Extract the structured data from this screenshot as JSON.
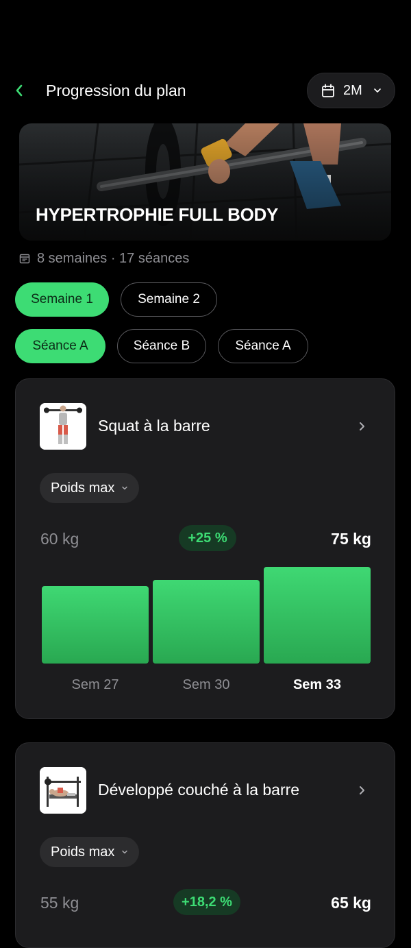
{
  "header": {
    "title": "Progression du plan",
    "period": "2M"
  },
  "hero": {
    "title": "HYPERTROPHIE FULL BODY"
  },
  "meta": {
    "text": "8 semaines · 17 séances"
  },
  "weeks": [
    {
      "label": "Semaine 1",
      "active": true
    },
    {
      "label": "Semaine 2",
      "active": false
    }
  ],
  "sessions": [
    {
      "label": "Séance A",
      "active": true
    },
    {
      "label": "Séance B",
      "active": false
    },
    {
      "label": "Séance A",
      "active": false
    }
  ],
  "exercises": [
    {
      "name": "Squat à la barre",
      "metric": "Poids max",
      "start": "60 kg",
      "delta": "+25 %",
      "end": "75 kg",
      "chart_data": {
        "type": "bar",
        "categories": [
          "Sem 27",
          "Sem 30",
          "Sem 33"
        ],
        "values": [
          60,
          65,
          75
        ],
        "highlight_index": 2
      }
    },
    {
      "name": "Développé couché à la barre",
      "metric": "Poids max",
      "start": "55 kg",
      "delta": "+18,2 %",
      "end": "65 kg"
    }
  ],
  "colors": {
    "accent": "#3ddc74",
    "background": "#000000",
    "card": "#1c1c1e"
  }
}
